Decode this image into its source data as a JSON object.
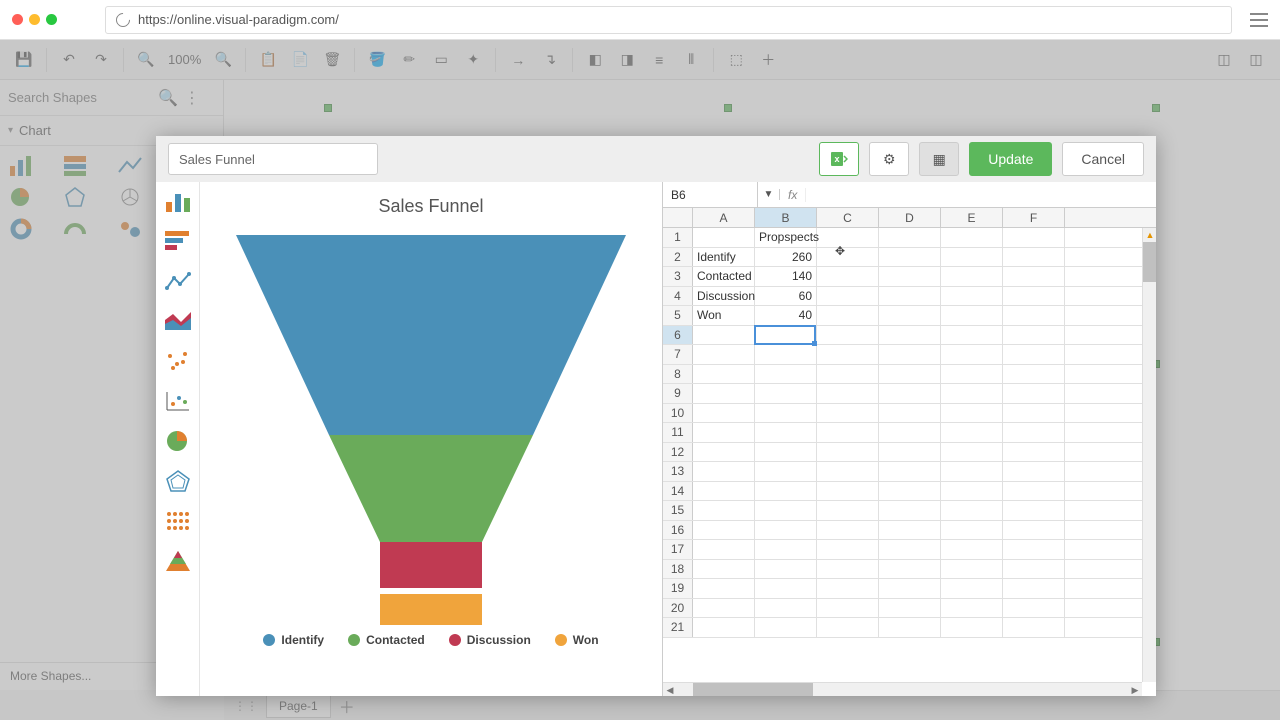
{
  "url": "https://online.visual-paradigm.com/",
  "toolbar": {
    "zoom": "100%"
  },
  "sidebar": {
    "search_placeholder": "Search Shapes",
    "category": "Chart",
    "more_shapes": "More Shapes..."
  },
  "page_tab": "Page-1",
  "modal": {
    "chart_name": "Sales Funnel",
    "update": "Update",
    "cancel": "Cancel"
  },
  "chart_data": {
    "type": "funnel",
    "title": "Sales Funnel",
    "series_name": "Propspects",
    "categories": [
      "Identify",
      "Contacted",
      "Discussion",
      "Won"
    ],
    "values": [
      260,
      140,
      60,
      40
    ],
    "colors": [
      "#4a90b8",
      "#6aab5a",
      "#c03a52",
      "#f0a43c"
    ]
  },
  "sheet": {
    "active_cell": "B6",
    "columns": [
      "A",
      "B",
      "C",
      "D",
      "E",
      "F"
    ],
    "rows": 21,
    "data": {
      "B1": "Propspects",
      "A2": "Identify",
      "B2": "260",
      "A3": "Contacted",
      "B3": "140",
      "A4": "Discussion",
      "B4": "60",
      "A5": "Won",
      "B5": "40"
    }
  }
}
